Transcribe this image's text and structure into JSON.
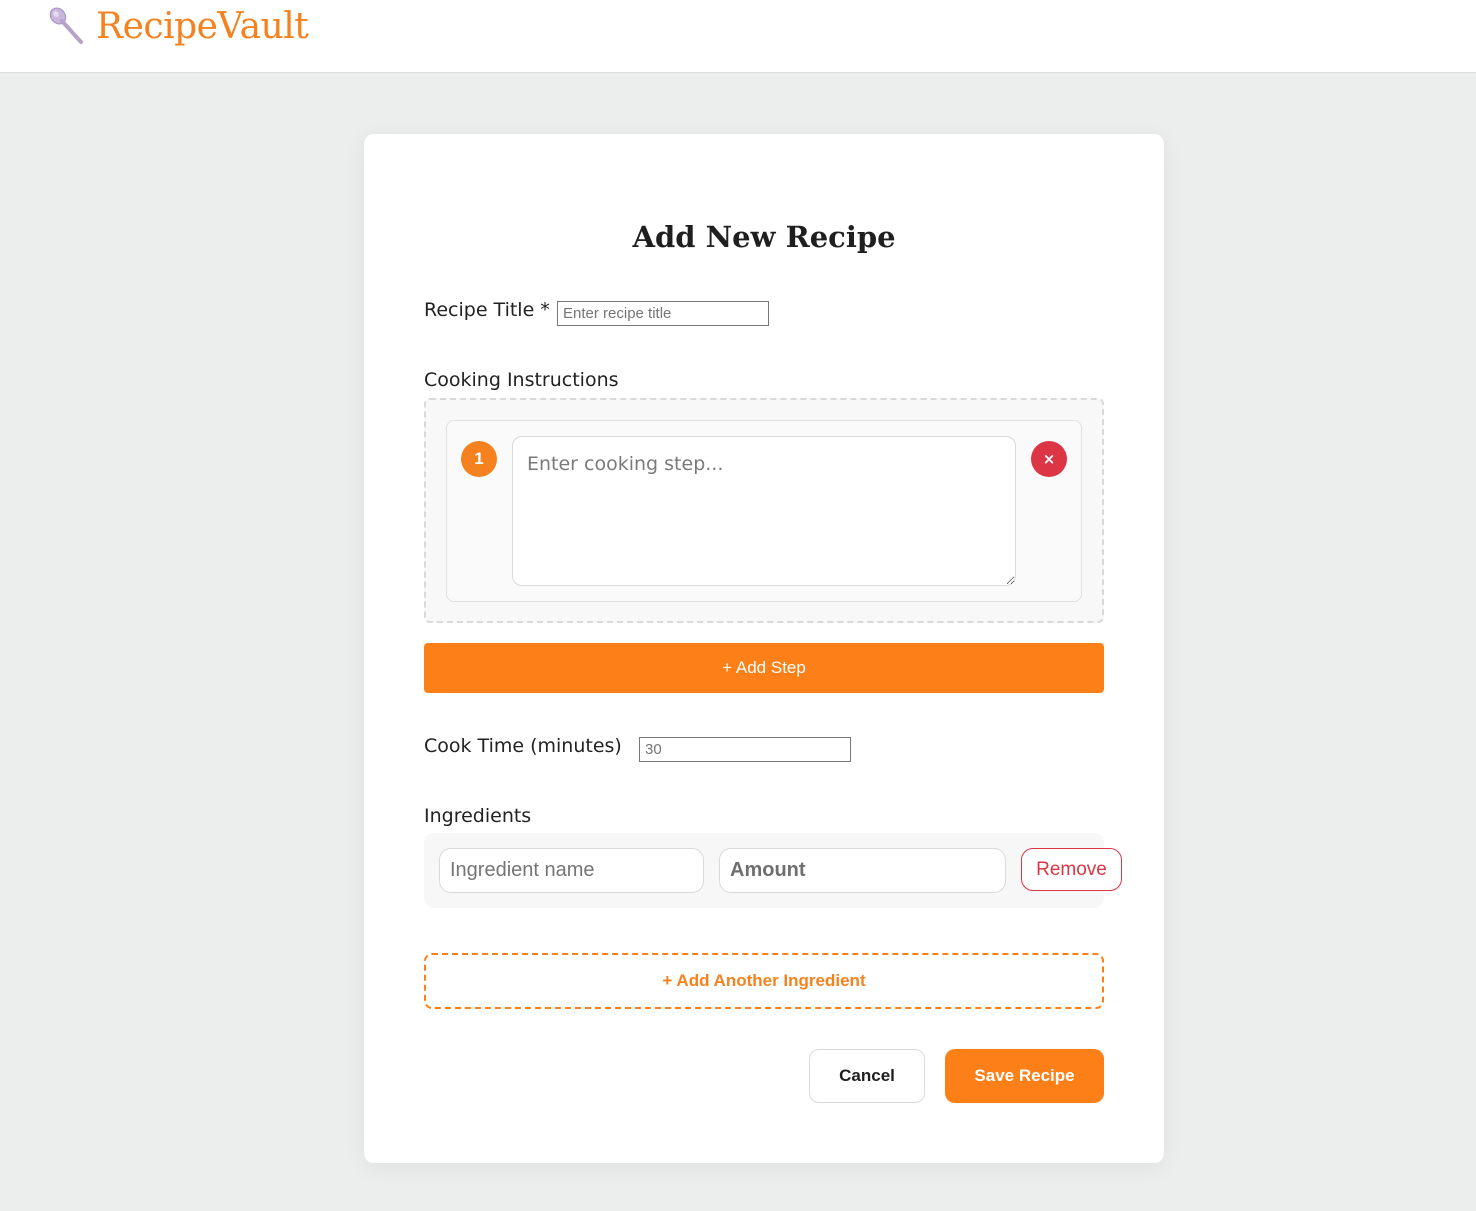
{
  "app": {
    "name": "RecipeVault",
    "logo_icon": "spoon-icon",
    "brand_color": "#f5821f"
  },
  "form": {
    "title": "Add New Recipe",
    "recipe_title": {
      "label": "Recipe Title *",
      "placeholder": "Enter recipe title",
      "value": ""
    },
    "instructions": {
      "label": "Cooking Instructions",
      "steps": [
        {
          "number": "1",
          "placeholder": "Enter cooking step...",
          "value": "",
          "remove_icon": "close-icon",
          "remove_label": "×"
        }
      ],
      "add_step_label": "+ Add Step"
    },
    "cook_time": {
      "label": "Cook Time (minutes)",
      "placeholder": "30",
      "value": ""
    },
    "ingredients": {
      "label": "Ingredients",
      "rows": [
        {
          "name_placeholder": "Ingredient name",
          "amount_placeholder": "Amount",
          "remove_label": "Remove"
        }
      ],
      "add_label": "+ Add Another Ingredient"
    },
    "actions": {
      "cancel_label": "Cancel",
      "save_label": "Save Recipe"
    }
  },
  "colors": {
    "accent": "#fd7f18",
    "danger": "#dc3545",
    "background": "#eceeee"
  }
}
